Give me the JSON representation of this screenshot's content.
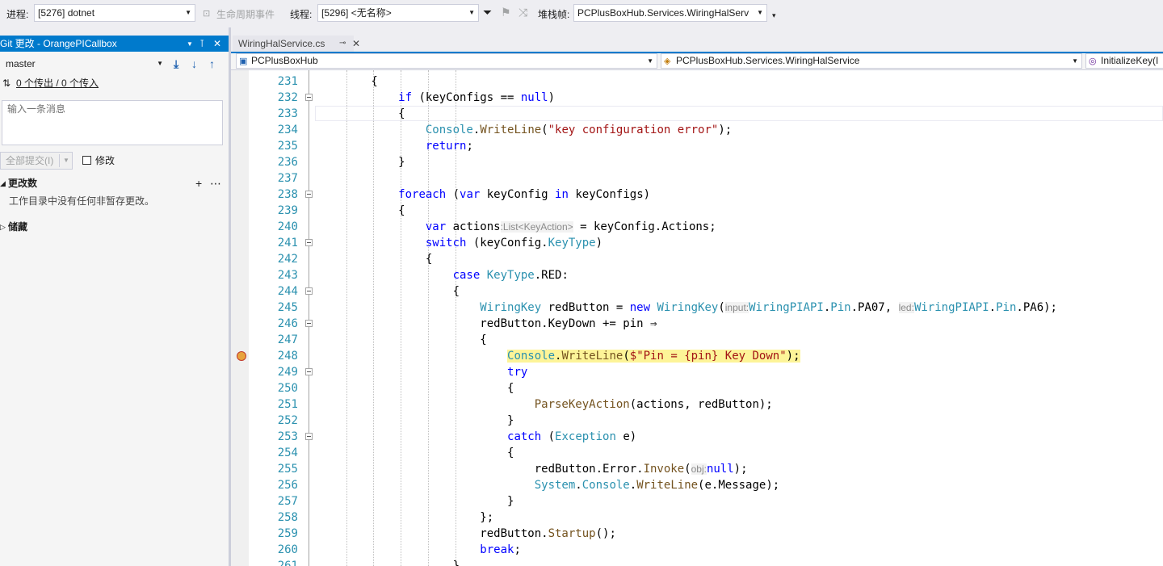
{
  "toolbar": {
    "process_label": "进程:",
    "process_value": "[5276] dotnet",
    "lifecycle_label": "生命周期事件",
    "thread_label": "线程:",
    "thread_value": "[5296] <无名称>",
    "stackframe_label": "堆栈帧:",
    "stackframe_value": "PCPlusBoxHub.Services.WiringHalServ"
  },
  "git_panel": {
    "title": "Git 更改 - OrangePICallbox",
    "branch": "master",
    "sync_text": "0 个传出 / 0 个传入",
    "message_placeholder": "输入一条消息",
    "commit_all_label": "全部提交(I)",
    "amend_label": "修改",
    "changes_header": "更改数",
    "changes_empty": "工作目录中没有任何非暂存更改。",
    "stashes_header": "储藏"
  },
  "editor": {
    "tab_name": "WiringHalService.cs",
    "nav_project": "PCPlusBoxHub",
    "nav_class": "PCPlusBoxHub.Services.WiringHalService",
    "nav_member": "InitializeKey(I",
    "accent": "#007acc",
    "highlight_color": "#fdf498"
  },
  "code_lines": [
    {
      "n": "231",
      "text": "        {"
    },
    {
      "n": "232",
      "text": "            if (keyConfigs == null)"
    },
    {
      "n": "233",
      "text": "            {"
    },
    {
      "n": "234",
      "text": "                Console.WriteLine(\"key configuration error\");"
    },
    {
      "n": "235",
      "text": "                return;"
    },
    {
      "n": "236",
      "text": "            }"
    },
    {
      "n": "237",
      "text": ""
    },
    {
      "n": "238",
      "text": "            foreach (var keyConfig in keyConfigs)"
    },
    {
      "n": "239",
      "text": "            {"
    },
    {
      "n": "240",
      "text": "                var actions:List<KeyAction> = keyConfig.Actions;"
    },
    {
      "n": "241",
      "text": "                switch (keyConfig.KeyType)"
    },
    {
      "n": "242",
      "text": "                {"
    },
    {
      "n": "243",
      "text": "                    case KeyType.RED:"
    },
    {
      "n": "244",
      "text": "                    {"
    },
    {
      "n": "245",
      "text": "                        WiringKey redButton = new WiringKey(input:WiringPIAPI.Pin.PA07, led:WiringPIAPI.Pin.PA6);"
    },
    {
      "n": "246",
      "text": "                        redButton.KeyDown += pin ⇒"
    },
    {
      "n": "247",
      "text": "                        {"
    },
    {
      "n": "248",
      "text": "                            Console.WriteLine($\"Pin = {pin} Key Down\");"
    },
    {
      "n": "249",
      "text": "                            try"
    },
    {
      "n": "250",
      "text": "                            {"
    },
    {
      "n": "251",
      "text": "                                ParseKeyAction(actions, redButton);"
    },
    {
      "n": "252",
      "text": "                            }"
    },
    {
      "n": "253",
      "text": "                            catch (Exception e)"
    },
    {
      "n": "254",
      "text": "                            {"
    },
    {
      "n": "255",
      "text": "                                redButton.Error.Invoke(obj:null);"
    },
    {
      "n": "256",
      "text": "                                System.Console.WriteLine(e.Message);"
    },
    {
      "n": "257",
      "text": "                            }"
    },
    {
      "n": "258",
      "text": "                        };"
    },
    {
      "n": "259",
      "text": "                        redButton.Startup();"
    },
    {
      "n": "260",
      "text": "                        break;"
    },
    {
      "n": "261",
      "text": "                    }"
    }
  ]
}
